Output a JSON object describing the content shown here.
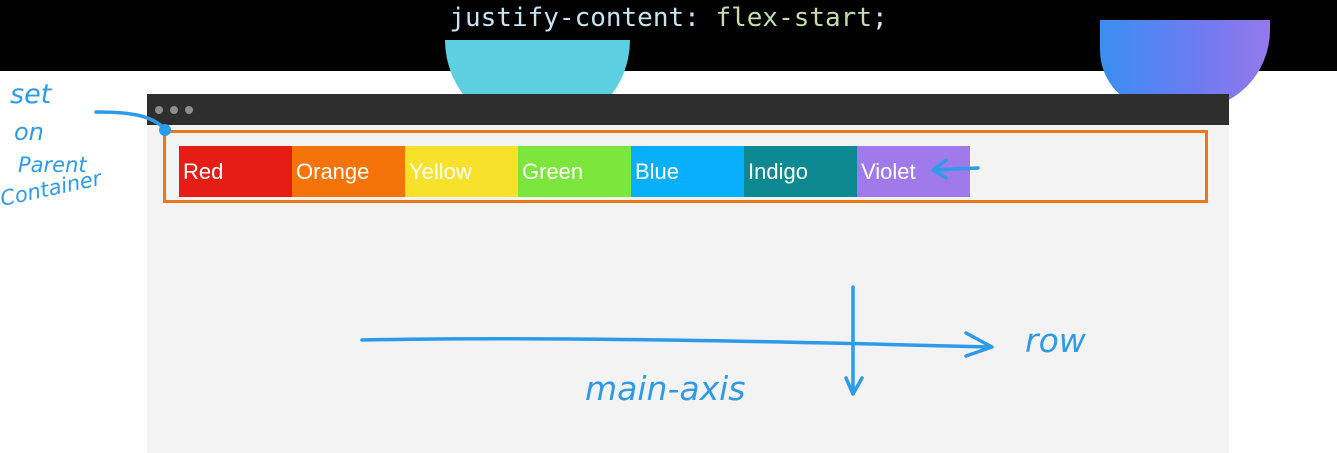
{
  "caption": {
    "property": "justify-content:",
    "value": "flex-start",
    "semicolon": ";"
  },
  "browser": {
    "window_controls": [
      "dot",
      "dot",
      "dot"
    ]
  },
  "flex_items": [
    {
      "label": "Red",
      "color": "#e61d15"
    },
    {
      "label": "Orange",
      "color": "#f47409"
    },
    {
      "label": "Yellow",
      "color": "#f7e12a"
    },
    {
      "label": "Green",
      "color": "#7de63c"
    },
    {
      "label": "Blue",
      "color": "#08b0fb"
    },
    {
      "label": "Indigo",
      "color": "#0d8a91"
    },
    {
      "label": "Violet",
      "color": "#a07aeb"
    }
  ],
  "annotations": {
    "note_lines": [
      "set",
      "on",
      "Parent",
      "Container"
    ],
    "axis_label": "main-axis",
    "direction_label": "row",
    "ink_color": "#2d9be8",
    "container_border_color": "#e7781c"
  }
}
